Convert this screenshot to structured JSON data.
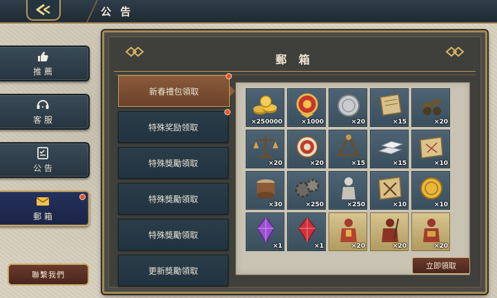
{
  "topbar": {
    "title": "公 告"
  },
  "side_menu": {
    "items": [
      {
        "label": "推 薦",
        "icon": "thumbs-up-icon"
      },
      {
        "label": "客 服",
        "icon": "headset-icon"
      },
      {
        "label": "公 告",
        "icon": "notice-icon"
      },
      {
        "label": "郵 箱",
        "icon": "mail-icon",
        "active": true,
        "badge": true
      }
    ],
    "contact_label": "聯繫我們"
  },
  "panel": {
    "title": "郵 箱",
    "mails": [
      {
        "label": "新春禮包領取",
        "selected": true,
        "badge": true
      },
      {
        "label": "特殊奖励领取",
        "badge": true
      },
      {
        "label": "特殊獎勵領取"
      },
      {
        "label": "特殊獎勵領取"
      },
      {
        "label": "特殊獎勵領取"
      },
      {
        "label": "更新獎勵領取"
      }
    ],
    "rewards": [
      {
        "icon": "gold-coins-icon",
        "qty": "×250000"
      },
      {
        "icon": "medal-icon",
        "qty": "×1000"
      },
      {
        "icon": "silver-coin-icon",
        "qty": "×20"
      },
      {
        "icon": "scroll-icon",
        "qty": "×15"
      },
      {
        "icon": "cannon-icon",
        "qty": "×20"
      },
      {
        "icon": "scale-icon",
        "qty": "×20"
      },
      {
        "icon": "target-icon",
        "qty": "×20"
      },
      {
        "icon": "catapult-icon",
        "qty": "×15"
      },
      {
        "icon": "silver-bars-icon",
        "qty": "×15"
      },
      {
        "icon": "map-scroll-icon",
        "qty": "×10"
      },
      {
        "icon": "drum-icon",
        "qty": "×30"
      },
      {
        "icon": "gears-icon",
        "qty": "×250"
      },
      {
        "icon": "statue-icon",
        "qty": "×250"
      },
      {
        "icon": "weapons-scroll-icon",
        "qty": "×10"
      },
      {
        "icon": "gold-coin-icon",
        "qty": "×10"
      },
      {
        "icon": "purple-gem-icon",
        "qty": "×1"
      },
      {
        "icon": "red-gem-icon",
        "qty": "×1"
      },
      {
        "icon": "warrior-card-icon",
        "qty": "×20",
        "gold": true
      },
      {
        "icon": "warrior-card-icon",
        "qty": "×20",
        "gold": true
      },
      {
        "icon": "warrior-card-icon",
        "qty": "×20",
        "gold": true
      }
    ],
    "claim_label": "立即領取"
  },
  "colors": {
    "accent_gold": "#c9a860",
    "badge_red": "#e2572a",
    "selected_mail": "#8a5a3b",
    "button_brown": "#5b2f23"
  }
}
